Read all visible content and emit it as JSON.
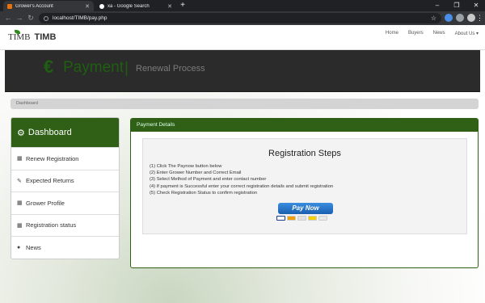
{
  "browser": {
    "tabs": [
      {
        "title": "Grower's Account",
        "favicon_color": "#e8710a",
        "active": true
      },
      {
        "title": "xa - Google Search",
        "favicon_color": "#ffffff",
        "active": false
      }
    ],
    "url": "localhost/TIMB/pay.php"
  },
  "site": {
    "logo_mark": "TIMB",
    "logo_text": "TIMB",
    "nav": [
      "Home",
      "Buyers",
      "News",
      "About Us ▾"
    ]
  },
  "banner": {
    "symbol": "€",
    "title": "Payment",
    "separator": "|",
    "subtitle": "Renewal Process"
  },
  "breadcrumb": "Dashboard",
  "sidebar": {
    "heading": "Dashboard",
    "items": [
      {
        "label": "Renew Registration",
        "icon": "table-icon"
      },
      {
        "label": "Expected Returns",
        "icon": "pencil-icon"
      },
      {
        "label": "Grower Profile",
        "icon": "table-icon"
      },
      {
        "label": "Registration status",
        "icon": "table-icon"
      },
      {
        "label": "News",
        "icon": "user-icon"
      }
    ]
  },
  "panel": {
    "heading": "Payment Details",
    "title": "Registration Steps",
    "steps": [
      "(1) Click The Paynow button below",
      "(2) Enter Grower Number and Correct Email",
      "(3) Select Method of Payment and enter contact number",
      "(4) If payment is Successful enter your correct registration details and submit registration",
      "(5) Check Registration Status to confirm registration"
    ],
    "button": "Pay Now"
  },
  "colors": {
    "brand_green": "#2f6015",
    "banner_bg": "#2b2b2b"
  }
}
